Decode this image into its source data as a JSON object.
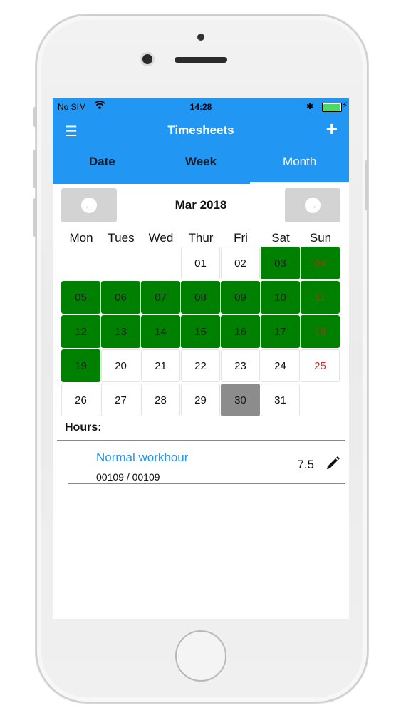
{
  "status_bar": {
    "carrier": "No SIM",
    "time": "14:28"
  },
  "app_bar": {
    "title": "Timesheets",
    "menu_icon": "menu-icon",
    "add_icon": "plus-icon"
  },
  "tabs": [
    {
      "label": "Date",
      "active": false
    },
    {
      "label": "Week",
      "active": false
    },
    {
      "label": "Month",
      "active": true
    }
  ],
  "calendar": {
    "month_label": "Mar 2018",
    "weekdays": [
      "Mon",
      "Tues",
      "Wed",
      "Thur",
      "Fri",
      "Sat",
      "Sun"
    ],
    "weeks": [
      [
        "",
        "",
        "",
        "01",
        "02",
        "03",
        "04"
      ],
      [
        "05",
        "06",
        "07",
        "08",
        "09",
        "10",
        "11"
      ],
      [
        "12",
        "13",
        "14",
        "15",
        "16",
        "17",
        "18"
      ],
      [
        "19",
        "20",
        "21",
        "22",
        "23",
        "24",
        "25"
      ],
      [
        "26",
        "27",
        "28",
        "29",
        "30",
        "31",
        ""
      ]
    ],
    "logged_days": [
      "03",
      "04",
      "05",
      "06",
      "07",
      "08",
      "09",
      "10",
      "11",
      "12",
      "13",
      "14",
      "15",
      "16",
      "17",
      "18",
      "19"
    ],
    "holiday_days": [
      "04",
      "11",
      "18",
      "25"
    ],
    "selected_day": "30",
    "colors": {
      "logged": "#008000",
      "selected": "#8c8c8c",
      "holiday_text": "#d32f2f",
      "accent": "#2196f3"
    }
  },
  "hours": {
    "label": "Hours:",
    "entries": [
      {
        "type": "Normal workhour",
        "code": "00109 / 00109",
        "hours": "7.5"
      }
    ]
  }
}
